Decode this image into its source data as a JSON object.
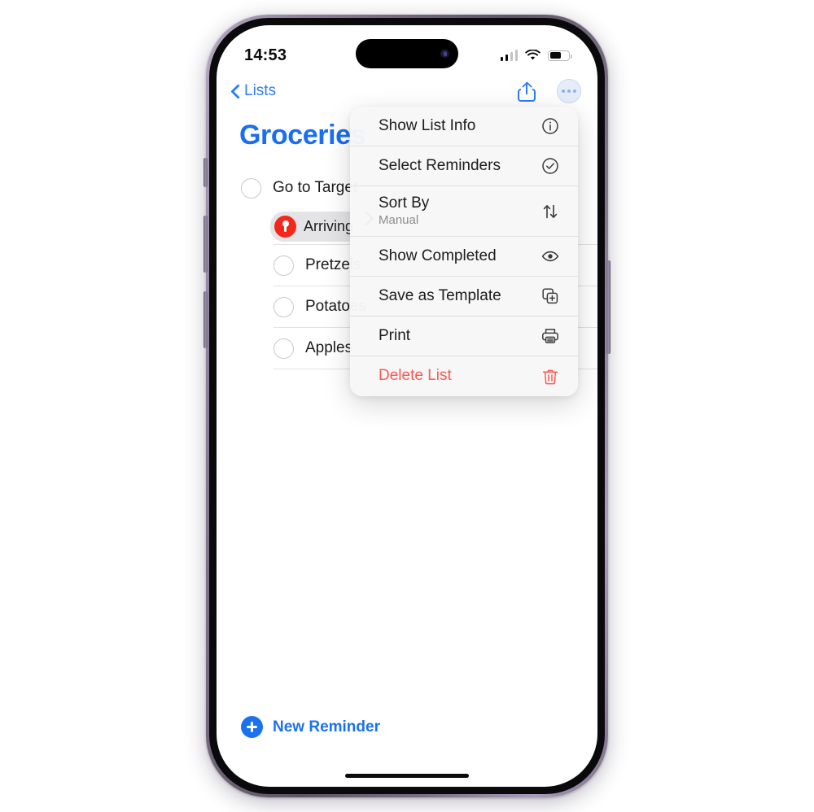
{
  "status_bar": {
    "time": "14:53",
    "signal_icon": "cellular-signal-icon",
    "signal_bars_filled": 2,
    "signal_bars_total": 4,
    "wifi_icon": "wifi-icon",
    "battery_icon": "battery-icon",
    "battery_percent": 55
  },
  "nav_bar": {
    "back_label": "Lists",
    "back_icon": "chevron-left-icon",
    "share_icon": "share-icon",
    "more_icon": "ellipsis-circle-icon"
  },
  "list": {
    "title": "Groceries",
    "title_color": "#1a6ef0",
    "items": [
      {
        "text": "Go to Target",
        "level": 0,
        "completed": false
      },
      {
        "text": "Pretzels",
        "level": 1,
        "completed": false
      },
      {
        "text": "Potatoes",
        "level": 1,
        "completed": false
      },
      {
        "text": "Apples",
        "level": 1,
        "completed": false
      }
    ],
    "location_badge": {
      "text": "Arriving",
      "icon": "location-pin-icon",
      "color": "#f4271c"
    }
  },
  "context_menu": {
    "submenu_chevron_icon": "chevron-right-icon",
    "items": [
      {
        "label": "Show List Info",
        "icon": "info-circle-icon",
        "sub": "",
        "destructive": false
      },
      {
        "label": "Select Reminders",
        "icon": "checkmark-circle-icon",
        "sub": "",
        "destructive": false
      },
      {
        "label": "Sort By",
        "icon": "arrow-up-down-icon",
        "sub": "Manual",
        "destructive": false
      },
      {
        "label": "Show Completed",
        "icon": "eye-icon",
        "sub": "",
        "destructive": false
      },
      {
        "label": "Save as Template",
        "icon": "duplicate-plus-icon",
        "sub": "",
        "destructive": false
      },
      {
        "label": "Print",
        "icon": "printer-icon",
        "sub": "",
        "destructive": false
      },
      {
        "label": "Delete List",
        "icon": "trash-icon",
        "sub": "",
        "destructive": true
      }
    ],
    "destructive_color": "#fb5a52"
  },
  "footer": {
    "new_reminder_label": "New Reminder",
    "add_icon": "plus-circle-icon",
    "accent_color": "#1a72f0"
  },
  "device": {
    "dynamic_island": "dynamic-island",
    "home_indicator": "home-indicator"
  }
}
